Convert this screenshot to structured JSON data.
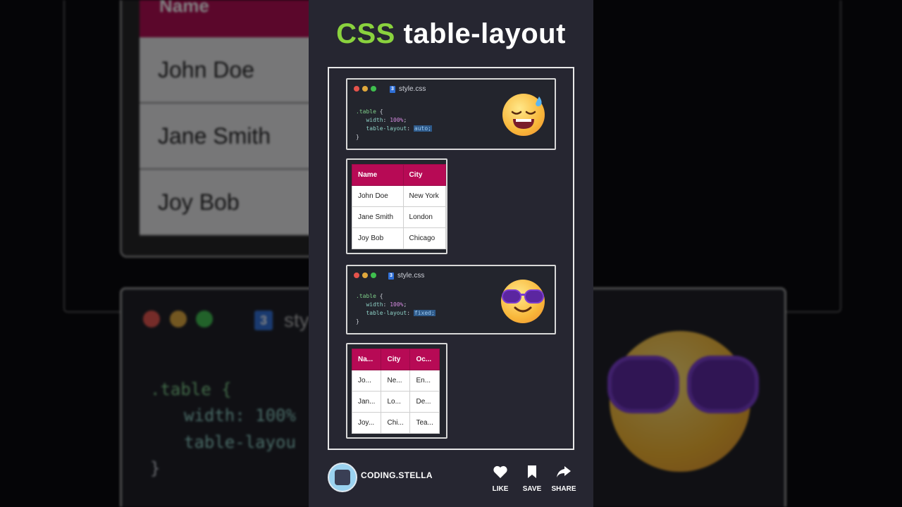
{
  "background": {
    "table": {
      "header": "Name",
      "rows": [
        "John Doe",
        "Jane Smith",
        "Joy Bob"
      ]
    },
    "code": {
      "filename": "sty",
      "lines": [
        ".table {",
        "width: 100%",
        "table-layou",
        "}"
      ]
    }
  },
  "title": {
    "prefix": "CSS",
    "rest": "table-layout"
  },
  "example_auto": {
    "filename": "style.css",
    "code": {
      "selector": ".table",
      "open": " {",
      "width_prop": "width",
      "width_val": "100%",
      "layout_prop": "table-layout",
      "layout_val": "auto;",
      "close": "}"
    },
    "emoji": "sweating-face-emoji",
    "table": {
      "headers": [
        "Name",
        "City"
      ],
      "rows": [
        [
          "John Doe",
          "New York"
        ],
        [
          "Jane Smith",
          "London"
        ],
        [
          "Joy Bob",
          "Chicago"
        ]
      ]
    }
  },
  "example_fixed": {
    "filename": "style.css",
    "code": {
      "selector": ".table",
      "open": " {",
      "width_prop": "width",
      "width_val": "100%",
      "layout_prop": "table-layout",
      "layout_val": "fixed;",
      "close": "}"
    },
    "emoji": "sunglasses-face-emoji",
    "table": {
      "headers": [
        "Na...",
        "City",
        "Oc..."
      ],
      "rows": [
        [
          "Jo...",
          "Ne...",
          "En..."
        ],
        [
          "Jan...",
          "Lo...",
          "De..."
        ],
        [
          "Joy...",
          "Chi...",
          "Tea..."
        ]
      ]
    }
  },
  "footer": {
    "channel": "CODING.STELLA",
    "actions": {
      "like": "LIKE",
      "save": "SAVE",
      "share": "SHARE"
    }
  },
  "colors": {
    "accent_green": "#8ad23e",
    "table_header": "#b70a55",
    "panel": "#262631"
  }
}
